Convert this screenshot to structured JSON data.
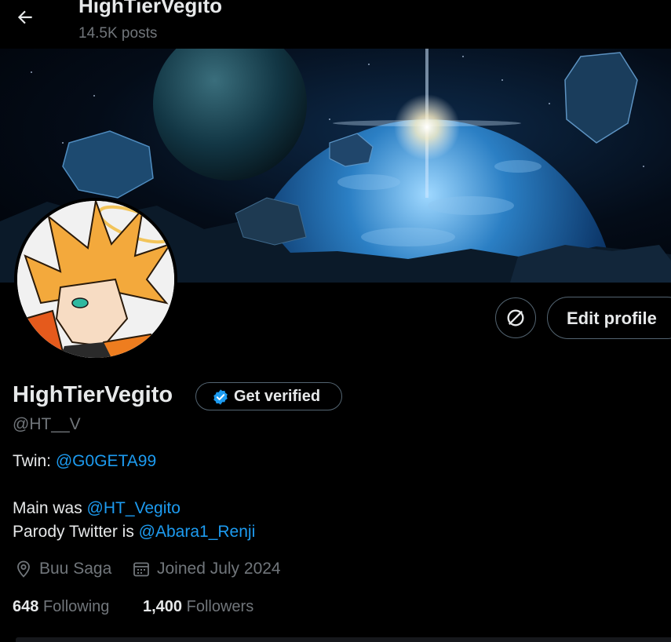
{
  "header": {
    "title": "HighTierVegito",
    "posts": "14.5K posts"
  },
  "profile": {
    "display_name": "HighTierVegito",
    "handle": "@HT__V",
    "get_verified": "Get verified",
    "edit_profile": "Edit profile"
  },
  "bio": {
    "twin_label": "Twin: ",
    "twin_link": "@G0GETA99",
    "main_label": "Main was ",
    "main_link": "@HT_Vegito",
    "parody_label": "Parody Twitter is ",
    "parody_link": "@Abara1_Renji"
  },
  "meta": {
    "location": "Buu Saga",
    "joined": "Joined July 2024"
  },
  "stats": {
    "following_count": "648",
    "following_label": "Following",
    "followers_count": "1,400",
    "followers_label": "Followers"
  },
  "colors": {
    "background": "#000000",
    "link": "#1d9bf0",
    "muted": "#71767b",
    "border": "#536471"
  },
  "icons": [
    "back-arrow-icon",
    "no-filter-icon",
    "verified-badge-icon",
    "location-pin-icon",
    "calendar-icon"
  ]
}
